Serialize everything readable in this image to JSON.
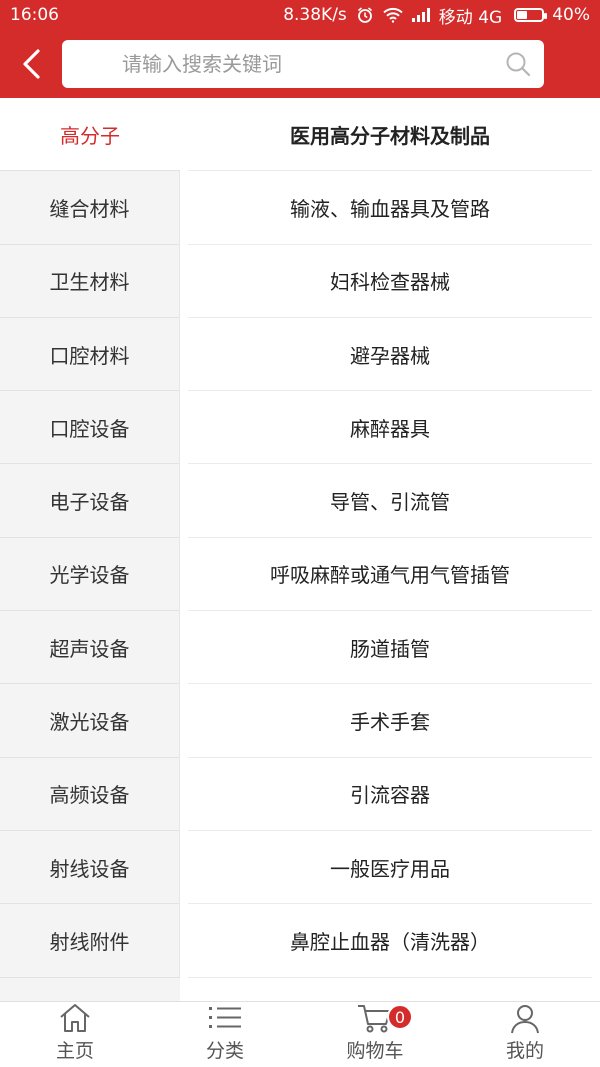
{
  "status_bar": {
    "time": "16:06",
    "speed": "8.38K/s",
    "carrier": "移动 4G",
    "battery": "40%",
    "battery_level": 0.4
  },
  "search": {
    "placeholder": "请输入搜索关键词"
  },
  "sidebar": {
    "items": [
      {
        "label": "高分子"
      },
      {
        "label": "缝合材料"
      },
      {
        "label": "卫生材料"
      },
      {
        "label": "口腔材料"
      },
      {
        "label": "口腔设备"
      },
      {
        "label": "电子设备"
      },
      {
        "label": "光学设备"
      },
      {
        "label": "超声设备"
      },
      {
        "label": "激光设备"
      },
      {
        "label": "高频设备"
      },
      {
        "label": "射线设备"
      },
      {
        "label": "射线附件"
      }
    ],
    "active_index": 0
  },
  "categories": {
    "items": [
      {
        "label": "医用高分子材料及制品"
      },
      {
        "label": "输液、输血器具及管路"
      },
      {
        "label": "妇科检查器械"
      },
      {
        "label": "避孕器械"
      },
      {
        "label": "麻醉器具"
      },
      {
        "label": "导管、引流管"
      },
      {
        "label": "呼吸麻醉或通气用气管插管"
      },
      {
        "label": "肠道插管"
      },
      {
        "label": "手术手套"
      },
      {
        "label": "引流容器"
      },
      {
        "label": "一般医疗用品"
      },
      {
        "label": "鼻腔止血器（清洗器）"
      }
    ]
  },
  "bottom_nav": {
    "home": "主页",
    "category": "分类",
    "cart": "购物车",
    "cart_count": "0",
    "mine": "我的"
  },
  "colors": {
    "brand": "#d42b2b"
  }
}
